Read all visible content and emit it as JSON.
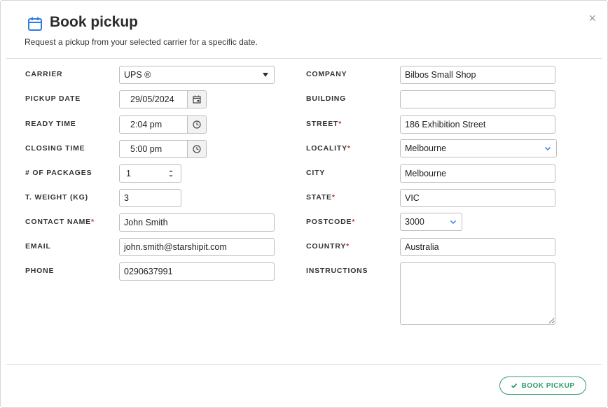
{
  "header": {
    "title": "Book pickup",
    "subtitle": "Request a pickup from your selected carrier for a specific date.",
    "close_glyph": "×",
    "icon": "calendar-icon"
  },
  "left": {
    "carrier": {
      "label": "CARRIER",
      "value": "UPS ®"
    },
    "pickup_date": {
      "label": "PICKUP DATE",
      "value": "29/05/2024"
    },
    "ready_time": {
      "label": "READY TIME",
      "value": "2:04 pm"
    },
    "closing_time": {
      "label": "CLOSING TIME",
      "value": "5:00 pm"
    },
    "packages": {
      "label": "# OF PACKAGES",
      "value": "1"
    },
    "weight": {
      "label": "T. WEIGHT (KG)",
      "value": "3"
    },
    "contact_name": {
      "label": "CONTACT NAME",
      "value": "John Smith",
      "required": "*"
    },
    "email": {
      "label": "EMAIL",
      "value": "john.smith@starshipit.com"
    },
    "phone": {
      "label": "PHONE",
      "value": "0290637991"
    }
  },
  "right": {
    "company": {
      "label": "COMPANY",
      "value": "Bilbos Small Shop"
    },
    "building": {
      "label": "BUILDING",
      "value": ""
    },
    "street": {
      "label": "STREET",
      "value": "186 Exhibition Street",
      "required": "*"
    },
    "locality": {
      "label": "LOCALITY",
      "value": "Melbourne",
      "required": "*"
    },
    "city": {
      "label": "CITY",
      "value": "Melbourne"
    },
    "state": {
      "label": "STATE",
      "value": "VIC",
      "required": "*"
    },
    "postcode": {
      "label": "POSTCODE",
      "value": "3000",
      "required": "*"
    },
    "country": {
      "label": "COUNTRY",
      "value": "Australia",
      "required": "*"
    },
    "instructions": {
      "label": "INSTRUCTIONS",
      "value": ""
    }
  },
  "footer": {
    "book_label": "BOOK PICKUP",
    "book_icon": "check-icon"
  },
  "colors": {
    "accent_green": "#2e9e6b",
    "icon_blue": "#2f7de1",
    "required_red": "#c0392b"
  }
}
